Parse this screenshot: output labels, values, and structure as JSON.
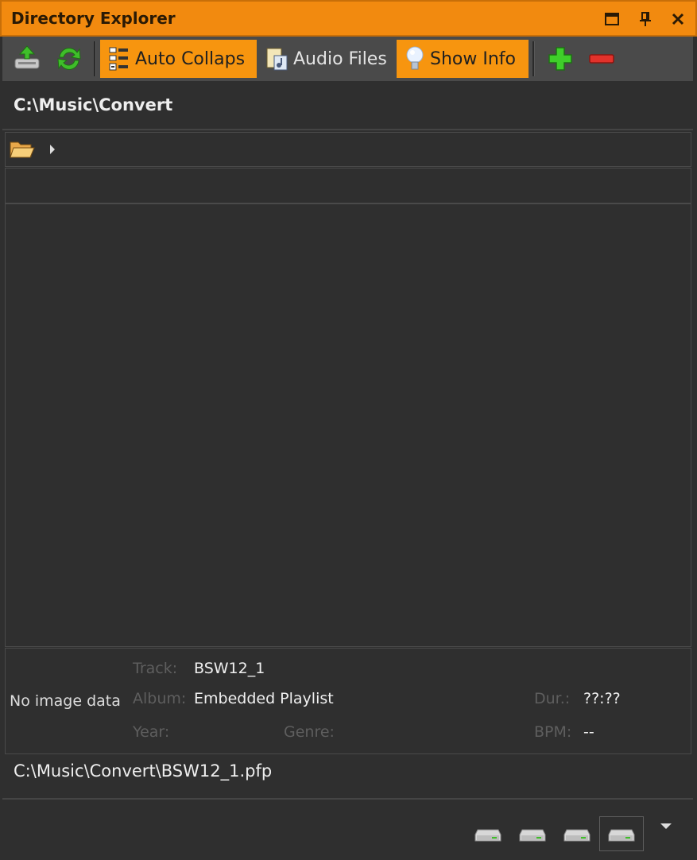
{
  "window": {
    "title": "Directory Explorer"
  },
  "toolbar": {
    "auto_collapse_label": "Auto Collaps",
    "audio_files_label": "Audio Files",
    "show_info_label": "Show Info"
  },
  "current_path": "C:\\Music\\Convert",
  "info": {
    "no_image_text": "No image data",
    "track_label": "Track:",
    "track_value": "BSW12_1",
    "album_label": "Album:",
    "album_value": "Embedded Playlist",
    "year_label": "Year:",
    "genre_label": "Genre:",
    "duration_label": "Dur.:",
    "duration_value": "??:??",
    "bpm_label": "BPM:",
    "bpm_value": "--"
  },
  "selected_file_path": "C:\\Music\\Convert\\BSW12_1.pfp",
  "colors": {
    "accent": "#f28a0f",
    "toggle_on": "#f7950f",
    "background": "#2f2f2f"
  }
}
